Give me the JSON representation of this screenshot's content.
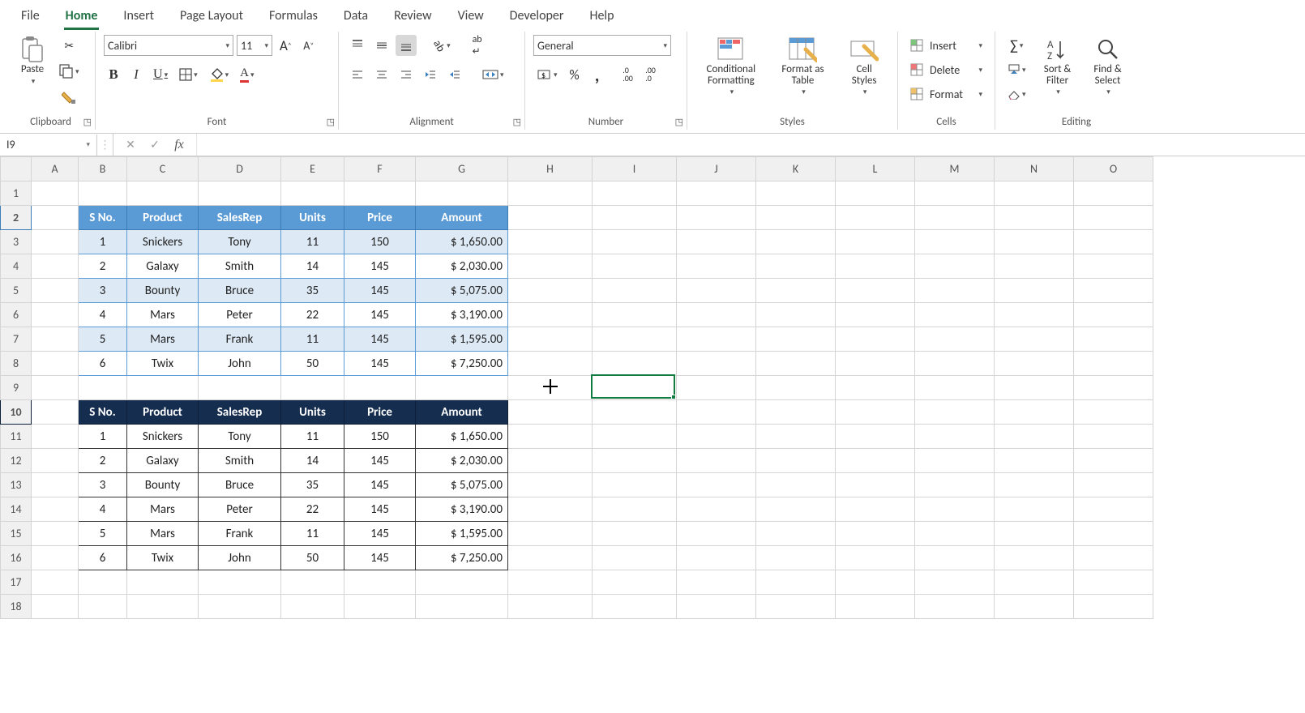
{
  "tabs": {
    "file": "File",
    "home": "Home",
    "insert": "Insert",
    "pagelayout": "Page Layout",
    "formulas": "Formulas",
    "data": "Data",
    "review": "Review",
    "view": "View",
    "developer": "Developer",
    "help": "Help"
  },
  "ribbon": {
    "clipboard": {
      "paste": "Paste",
      "label": "Clipboard"
    },
    "font": {
      "name": "Calibri",
      "size": "11",
      "label": "Font"
    },
    "alignment": {
      "label": "Alignment"
    },
    "number": {
      "format": "General",
      "label": "Number"
    },
    "styles": {
      "cond": "Conditional\nFormatting",
      "fmt": "Format as\nTable",
      "cell": "Cell\nStyles",
      "label": "Styles"
    },
    "cells": {
      "insert": "Insert",
      "delete": "Delete",
      "format": "Format",
      "label": "Cells"
    },
    "editing": {
      "sort": "Sort &\nFilter",
      "find": "Find &\nSelect",
      "label": "Editing"
    }
  },
  "namebox": "I9",
  "formula": "",
  "columns": [
    "A",
    "B",
    "C",
    "D",
    "E",
    "F",
    "G",
    "H",
    "I",
    "J",
    "K",
    "L",
    "M",
    "N",
    "O"
  ],
  "rows": [
    1,
    2,
    3,
    4,
    5,
    6,
    7,
    8,
    9,
    10,
    11,
    12,
    13,
    14,
    15,
    16,
    17,
    18
  ],
  "table": {
    "headers": [
      "S No.",
      "Product",
      "SalesRep",
      "Units",
      "Price",
      "Amount"
    ],
    "rows": [
      {
        "n": "1",
        "product": "Snickers",
        "rep": "Tony",
        "units": "11",
        "price": "150",
        "amount": "$ 1,650.00"
      },
      {
        "n": "2",
        "product": "Galaxy",
        "rep": "Smith",
        "units": "14",
        "price": "145",
        "amount": "$ 2,030.00"
      },
      {
        "n": "3",
        "product": "Bounty",
        "rep": "Bruce",
        "units": "35",
        "price": "145",
        "amount": "$ 5,075.00"
      },
      {
        "n": "4",
        "product": "Mars",
        "rep": "Peter",
        "units": "22",
        "price": "145",
        "amount": "$ 3,190.00"
      },
      {
        "n": "5",
        "product": "Mars",
        "rep": "Frank",
        "units": "11",
        "price": "145",
        "amount": "$ 1,595.00"
      },
      {
        "n": "6",
        "product": "Twix",
        "rep": "John",
        "units": "50",
        "price": "145",
        "amount": "$ 7,250.00"
      }
    ]
  }
}
